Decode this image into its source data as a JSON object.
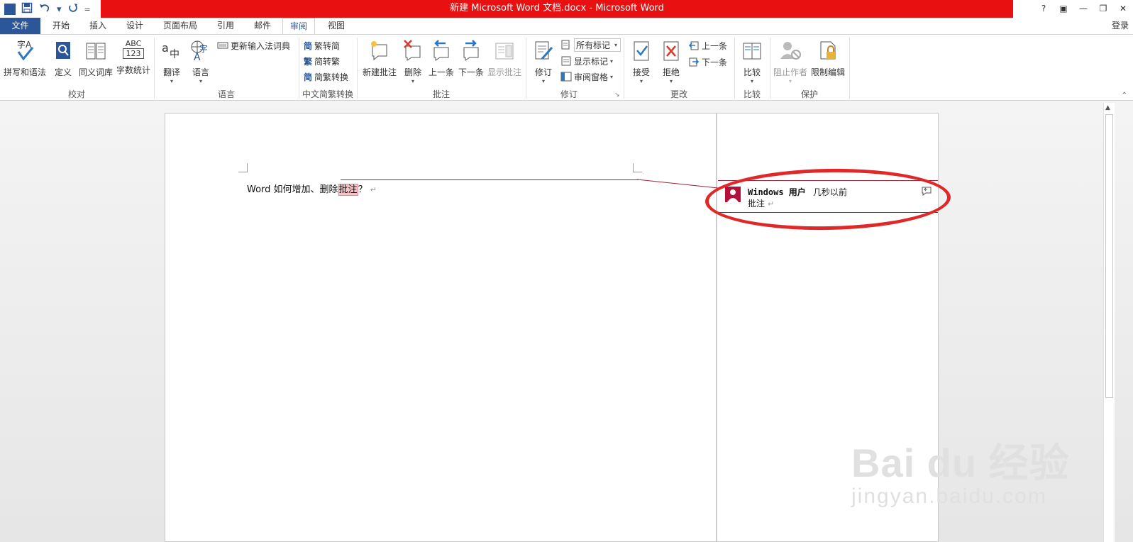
{
  "window": {
    "title": "新建 Microsoft Word 文档.docx - Microsoft Word",
    "title_bar_color": "#e81010",
    "controls": [
      "?",
      "▣",
      "—",
      "❐",
      "✕"
    ]
  },
  "quick_access": {
    "app_icon": "W",
    "undo_arrow": "▾",
    "customize": "="
  },
  "tabs": {
    "file": "文件",
    "home": "开始",
    "insert": "插入",
    "design": "设计",
    "layout": "页面布局",
    "references": "引用",
    "mailings": "邮件",
    "review": "审阅",
    "view": "视图"
  },
  "account": {
    "login": "登录"
  },
  "ribbon": {
    "proofing": {
      "label": "校对",
      "spelling": "拼写和语法",
      "define": "定义",
      "thesaurus": "同义词库",
      "word_count": "字数统计",
      "word_count_icon_text": "ABC",
      "word_count_icon_num": "123",
      "spelling_icon_text": "字A"
    },
    "language": {
      "label": "语言",
      "translate": "翻译",
      "language": "语言",
      "update_ime": "更新输入法词典",
      "translate_icon_text": "a中",
      "language_icon_text": "字"
    },
    "chinese_conversion": {
      "label": "中文简繁转换",
      "to_simplified": "繁转简",
      "to_traditional": "简转繁",
      "convert": "简繁转换",
      "icon_simp": "简",
      "icon_trad": "繁",
      "icon_conv": "简"
    },
    "comments": {
      "label": "批注",
      "new_comment": "新建批注",
      "delete": "删除",
      "previous": "上一条",
      "next": "下一条",
      "show_comments": "显示批注"
    },
    "tracking": {
      "label": "修订",
      "track_changes": "修订",
      "all_markup": "所有标记",
      "show_markup": "显示标记",
      "reviewing_pane": "审阅窗格"
    },
    "changes": {
      "label": "更改",
      "accept": "接受",
      "reject": "拒绝",
      "previous": "上一条",
      "next": "下一条"
    },
    "compare": {
      "label": "比较",
      "compare": "比较"
    },
    "protect": {
      "label": "保护",
      "block_authors": "阻止作者",
      "restrict_editing": "限制编辑"
    }
  },
  "document": {
    "text_before": "Word 如何增加、删除",
    "highlighted": "批注",
    "text_after": "？",
    "pilcrow": "↵"
  },
  "comment": {
    "author": "Windows 用户",
    "time": "几秒以前",
    "text": "批注",
    "pilcrow": "↵",
    "accent_color": "#a0223a"
  },
  "annotation": {
    "circle_color": "#e02828"
  },
  "watermark": {
    "brand": "Bai du 经验",
    "url": "jingyan.baidu.com"
  },
  "colors": {
    "word_blue": "#2b579a"
  }
}
